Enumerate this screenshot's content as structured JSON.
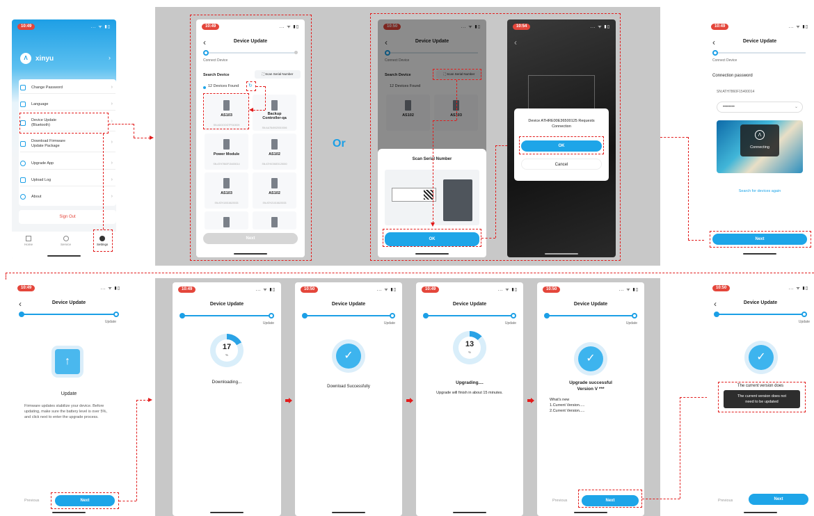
{
  "status": {
    "t1": "10:49",
    "t2": "10:49",
    "t3": "10:50",
    "t4": "10:54",
    "t5": "10:49",
    "b1": "10:49",
    "b2": "10:49",
    "b3": "10:50",
    "b4": "10:49",
    "b5": "10:50",
    "b6": "10:50",
    "signal": "... ᯤ ▮▯"
  },
  "or_label": "Or",
  "settings": {
    "username": "xinyu",
    "menu": [
      {
        "label": "Change Password"
      },
      {
        "label": "Language"
      },
      {
        "label": "Device Update\n(Bluetooth)"
      },
      {
        "label": "Download Firmware\nUpdate Package"
      },
      {
        "label": "Upgrade App"
      },
      {
        "label": "Upload Log"
      },
      {
        "label": "About"
      }
    ],
    "sign_out": "Sign Out",
    "tabs": [
      "Home",
      "Service",
      "Settings"
    ]
  },
  "device_update": {
    "title": "Device Update",
    "step1": "Connect Device",
    "step2": "Update",
    "search_device": "Search Device",
    "scan_serial": "Scan Serial Number",
    "devices_found": "12 Devices Found",
    "devices": [
      {
        "name": "AS103",
        "sn": "SN:ADOOOO7P010009"
      },
      {
        "name": "Backup\nController-qa",
        "sn": "SN:AA7849020010006"
      },
      {
        "name": "Power Module",
        "sn": "SN:ATH7860F15400014"
      },
      {
        "name": "AS102",
        "sn": "SN:ATHIO06E0125000"
      },
      {
        "name": "AS103",
        "sn": "SN:ATH10016620033"
      },
      {
        "name": "AS102",
        "sn": "SN:ATH21016620033"
      }
    ],
    "next": "Next",
    "previous": "Previous"
  },
  "scan_sheet": {
    "title": "Scan Serial Number",
    "ok": "OK"
  },
  "connect_dialog": {
    "message": "Device ATHRE00E36500125 Requests\nConnection",
    "ok": "OK",
    "cancel": "Cancel"
  },
  "connection": {
    "label": "Connection password",
    "sn": "SN:ATH7860F15400014",
    "password_mask": "••••••••",
    "connecting": "Connecting",
    "search_again": "Search for devices again"
  },
  "update": {
    "title": "Update",
    "desc": "Firmware updates stabilize your device. Before updating, make sure the battery level is over 5%, and click next to enter the upgrade process."
  },
  "downloading": {
    "percent_value": 17,
    "percent": "17",
    "unit": "%",
    "label": "Downloading..."
  },
  "download_done": {
    "label": "Download Successfully"
  },
  "upgrading": {
    "percent_value": 13,
    "percent": "13",
    "unit": "%",
    "label": "Upgrading....",
    "sub": "Upgrade will finish in about 15 minutes."
  },
  "upgrade_done": {
    "title": "Upgrade successful\nVersion V ***",
    "whats_new": "What's new",
    "line1": "1.Current Version.....",
    "line2": "2.Current Version....."
  },
  "current": {
    "faded": "The current version does",
    "toast": "The current version does not\nneed to be updated"
  },
  "colors": {
    "accent": "#1ea5e8",
    "annotation": "#e21b1b",
    "time_pill": "#e4463b"
  }
}
